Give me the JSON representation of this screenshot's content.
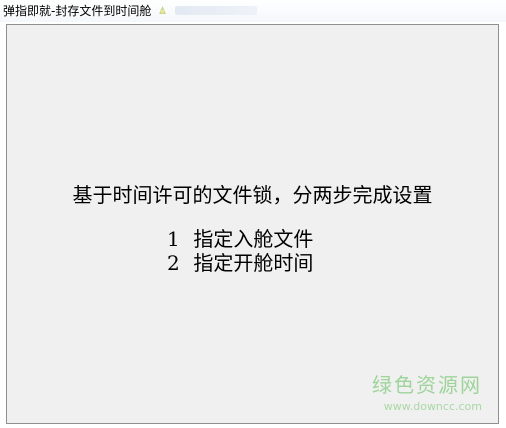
{
  "window": {
    "title": "弹指即就-封存文件到时间舱"
  },
  "content": {
    "heading": "基于时间许可的文件锁，分两步完成设置",
    "steps": [
      {
        "number": "1",
        "text": "指定入舱文件"
      },
      {
        "number": "2",
        "text": "指定开舱时间"
      }
    ]
  },
  "watermark": {
    "brand": "绿色资源网",
    "url": "www.downcc.com"
  },
  "colors": {
    "client_bg": "#f0f0f0",
    "watermark_green": "#9ed49a"
  }
}
